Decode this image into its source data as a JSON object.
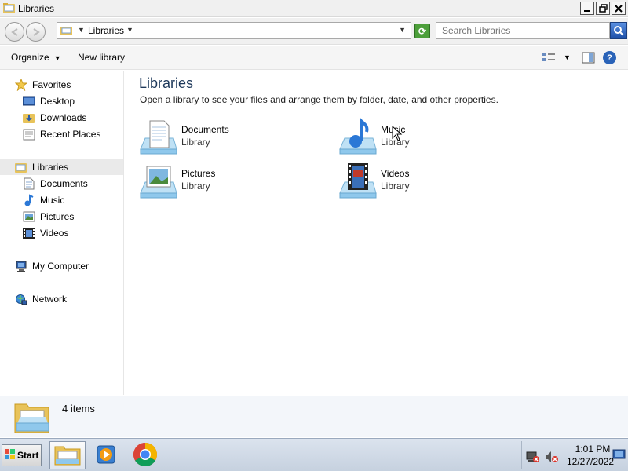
{
  "window": {
    "title": "Libraries"
  },
  "address": {
    "crumb": "Libraries"
  },
  "search": {
    "placeholder": "Search Libraries"
  },
  "commands": {
    "organize": "Organize",
    "new_library": "New library"
  },
  "nav": {
    "favorites": "Favorites",
    "favorites_items": [
      "Desktop",
      "Downloads",
      "Recent Places"
    ],
    "libraries": "Libraries",
    "library_items": [
      "Documents",
      "Music",
      "Pictures",
      "Videos"
    ],
    "computer": "My Computer",
    "network": "Network"
  },
  "content": {
    "title": "Libraries",
    "subtitle": "Open a library to see your files and arrange them by folder, date, and other properties.",
    "libraries": [
      {
        "name": "Documents",
        "type": "Library",
        "icon": "documents-library-icon"
      },
      {
        "name": "Music",
        "type": "Library",
        "icon": "music-library-icon"
      },
      {
        "name": "Pictures",
        "type": "Library",
        "icon": "pictures-library-icon"
      },
      {
        "name": "Videos",
        "type": "Library",
        "icon": "videos-library-icon"
      }
    ]
  },
  "details": {
    "count": "4 items"
  },
  "taskbar": {
    "start": "Start",
    "time": "1:01 PM",
    "date": "12/27/2022"
  },
  "colors": {
    "title_text": "#1e395b",
    "help_blue": "#2a63b8",
    "refresh_green": "#4c9f3a"
  }
}
